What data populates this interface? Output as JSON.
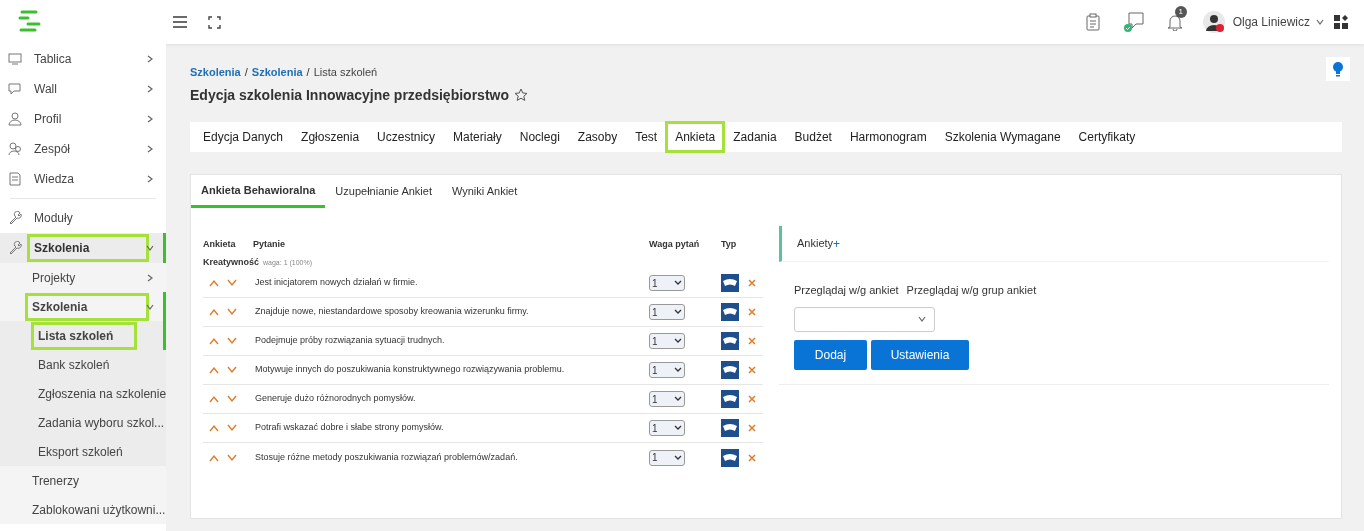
{
  "topbar": {
    "notification_count": "1",
    "user_name": "Olga Liniewicz"
  },
  "sidebar": {
    "items": [
      {
        "label": "Tablica",
        "expanded": false,
        "highlighted": false,
        "has_arrow": true
      },
      {
        "label": "Wall",
        "expanded": false,
        "highlighted": false,
        "has_arrow": true
      },
      {
        "label": "Profil",
        "expanded": false,
        "highlighted": false,
        "has_arrow": true
      },
      {
        "label": "Zespół",
        "expanded": false,
        "highlighted": false,
        "has_arrow": true
      },
      {
        "label": "Wiedza",
        "expanded": false,
        "highlighted": false,
        "has_arrow": true,
        "divider_after": true
      },
      {
        "label": "Moduły",
        "expanded": false,
        "highlighted": false,
        "has_arrow": false
      },
      {
        "label": "Szkolenia",
        "expanded": true,
        "highlighted": true,
        "has_arrow": true,
        "children": [
          {
            "label": "Projekty",
            "expanded": false,
            "highlighted": false,
            "has_arrow": true
          },
          {
            "label": "Szkolenia",
            "expanded": true,
            "highlighted": true,
            "has_arrow": true,
            "children": [
              {
                "label": "Lista szkoleń",
                "selected": true,
                "highlighted": true
              },
              {
                "label": "Bank szkoleń",
                "selected": false,
                "highlighted": false
              },
              {
                "label": "Zgłoszenia na szkolenie",
                "selected": false,
                "highlighted": false
              },
              {
                "label": "Zadania wyboru szkol...",
                "selected": false,
                "highlighted": false
              },
              {
                "label": "Eksport szkoleń",
                "selected": false,
                "highlighted": false
              }
            ]
          },
          {
            "label": "Trenerzy",
            "expanded": false,
            "highlighted": false,
            "has_arrow": false
          },
          {
            "label": "Zablokowani użytkowni...",
            "expanded": false,
            "highlighted": false
          }
        ]
      }
    ]
  },
  "breadcrumb": [
    {
      "label": "Szkolenia",
      "link": true
    },
    {
      "separator": "/",
      "label": "Szkolenia",
      "link": true
    },
    {
      "separator": "/",
      "label": "Lista szkoleń",
      "link": false
    }
  ],
  "page_title": "Edycja szkolenia Innowacyjne przedsiębiorstwo",
  "tabs": [
    {
      "label": "Edycja Danych",
      "selected": false
    },
    {
      "label": "Zgłoszenia",
      "selected": false
    },
    {
      "label": "Uczestnicy",
      "selected": false
    },
    {
      "label": "Materiały",
      "selected": false
    },
    {
      "label": "Noclegi",
      "selected": false
    },
    {
      "label": "Zasoby",
      "selected": false
    },
    {
      "label": "Test",
      "selected": false
    },
    {
      "label": "Ankieta",
      "selected": true
    },
    {
      "label": "Zadania",
      "selected": false
    },
    {
      "label": "Budżet",
      "selected": false
    },
    {
      "label": "Harmonogram",
      "selected": false
    },
    {
      "label": "Szkolenia Wymagane",
      "selected": false
    },
    {
      "label": "Certyfikaty",
      "selected": false
    }
  ],
  "subtabs": [
    {
      "label": "Ankieta Behawioralna",
      "selected": true
    },
    {
      "label": "Uzupełnianie Ankiet",
      "selected": false
    },
    {
      "label": "Wyniki Ankiet",
      "selected": false
    }
  ],
  "table": {
    "columns": [
      "Ankieta",
      "Pytanie",
      "Waga pytań",
      "Typ"
    ],
    "group": {
      "name": "Kreatywność",
      "weight": "waga: 1 (100%)"
    },
    "rows": [
      {
        "question": "Jest inicjatorem nowych działań w firmie.",
        "weight": "1"
      },
      {
        "question": "Znajduje nowe, niestandardowe sposoby kreowania wizerunku firmy.",
        "weight": "1"
      },
      {
        "question": "Podejmuje próby rozwiązania sytuacji trudnych.",
        "weight": "1"
      },
      {
        "question": "Motywuje innych do poszukiwania konstruktywnego rozwiązywania problemu.",
        "weight": "1"
      },
      {
        "question": "Generuje dużo różnorodnych pomysłów.",
        "weight": "1"
      },
      {
        "question": "Potrafi wskazać dobre i słabe strony pomysłów.",
        "weight": "1"
      },
      {
        "question": "Stosuje różne metody poszukiwania rozwiązań problemów/zadań.",
        "weight": "1"
      }
    ]
  },
  "panel": {
    "title": "Ankiety",
    "add": "+",
    "views": [
      "Przeglądaj w/g ankiet",
      "Przeglądaj w/g grup ankiet"
    ],
    "buttons": [
      "Dodaj",
      "Ustawienia"
    ]
  }
}
